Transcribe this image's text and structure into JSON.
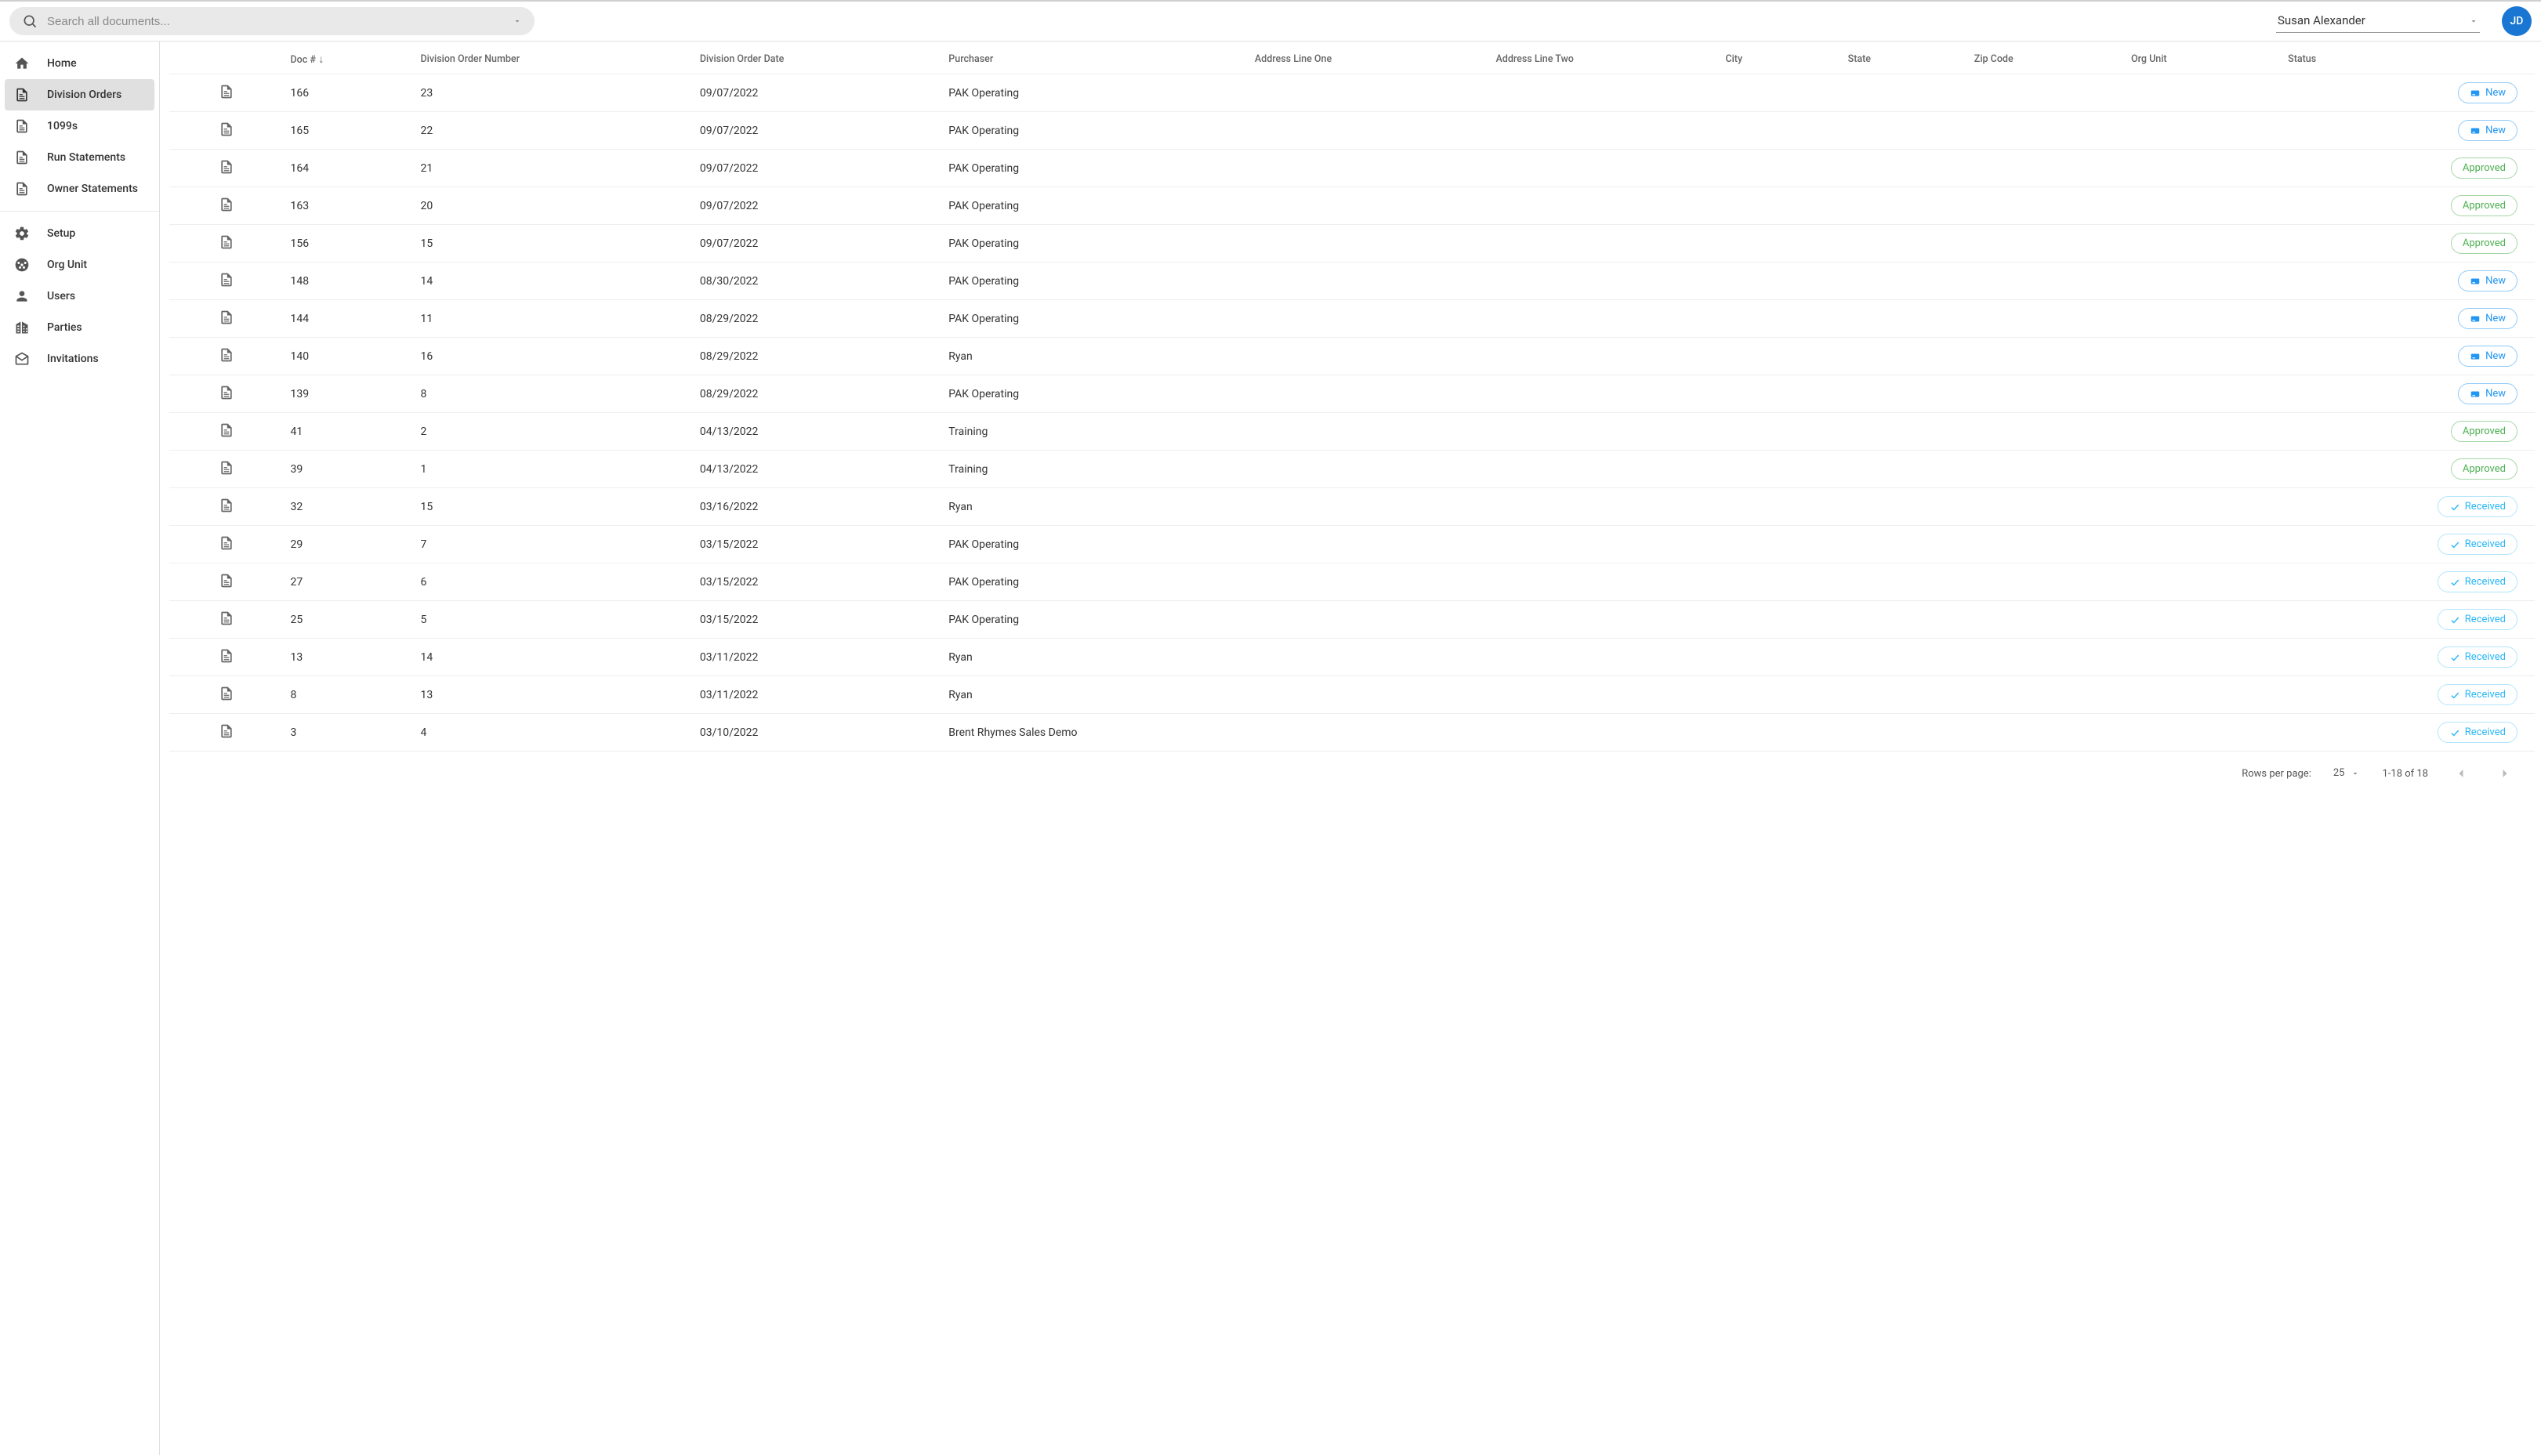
{
  "header": {
    "search_placeholder": "Search all documents...",
    "user_name": "Susan Alexander",
    "avatar_initials": "JD"
  },
  "sidebar": {
    "items": [
      {
        "icon": "home",
        "label": "Home"
      },
      {
        "icon": "doc",
        "label": "Division Orders",
        "active": true
      },
      {
        "icon": "doc",
        "label": "1099s"
      },
      {
        "icon": "doc",
        "label": "Run Statements"
      },
      {
        "icon": "doc",
        "label": "Owner Statements"
      },
      {
        "divider": true
      },
      {
        "icon": "gear",
        "label": "Setup"
      },
      {
        "icon": "org",
        "label": "Org Unit"
      },
      {
        "icon": "user",
        "label": "Users"
      },
      {
        "icon": "building",
        "label": "Parties"
      },
      {
        "icon": "mail",
        "label": "Invitations"
      }
    ]
  },
  "table": {
    "columns": [
      {
        "key": "icon",
        "label": ""
      },
      {
        "key": "doc_num",
        "label": "Doc #",
        "sorted": "desc"
      },
      {
        "key": "don",
        "label": "Division Order Number"
      },
      {
        "key": "date",
        "label": "Division Order Date"
      },
      {
        "key": "purchaser",
        "label": "Purchaser"
      },
      {
        "key": "addr1",
        "label": "Address Line One"
      },
      {
        "key": "addr2",
        "label": "Address Line Two"
      },
      {
        "key": "city",
        "label": "City"
      },
      {
        "key": "state",
        "label": "State"
      },
      {
        "key": "zip",
        "label": "Zip Code"
      },
      {
        "key": "org",
        "label": "Org Unit"
      },
      {
        "key": "status",
        "label": "Status"
      }
    ],
    "rows": [
      {
        "doc_num": "166",
        "don": "23",
        "date": "09/07/2022",
        "purchaser": "PAK Operating",
        "status": "New"
      },
      {
        "doc_num": "165",
        "don": "22",
        "date": "09/07/2022",
        "purchaser": "PAK Operating",
        "status": "New"
      },
      {
        "doc_num": "164",
        "don": "21",
        "date": "09/07/2022",
        "purchaser": "PAK Operating",
        "status": "Approved"
      },
      {
        "doc_num": "163",
        "don": "20",
        "date": "09/07/2022",
        "purchaser": "PAK Operating",
        "status": "Approved"
      },
      {
        "doc_num": "156",
        "don": "15",
        "date": "09/07/2022",
        "purchaser": "PAK Operating",
        "status": "Approved"
      },
      {
        "doc_num": "148",
        "don": "14",
        "date": "08/30/2022",
        "purchaser": "PAK Operating",
        "status": "New"
      },
      {
        "doc_num": "144",
        "don": "11",
        "date": "08/29/2022",
        "purchaser": "PAK Operating",
        "status": "New"
      },
      {
        "doc_num": "140",
        "don": "16",
        "date": "08/29/2022",
        "purchaser": "Ryan",
        "status": "New"
      },
      {
        "doc_num": "139",
        "don": "8",
        "date": "08/29/2022",
        "purchaser": "PAK Operating",
        "status": "New"
      },
      {
        "doc_num": "41",
        "don": "2",
        "date": "04/13/2022",
        "purchaser": "Training",
        "status": "Approved"
      },
      {
        "doc_num": "39",
        "don": "1",
        "date": "04/13/2022",
        "purchaser": "Training",
        "status": "Approved"
      },
      {
        "doc_num": "32",
        "don": "15",
        "date": "03/16/2022",
        "purchaser": "Ryan",
        "status": "Received"
      },
      {
        "doc_num": "29",
        "don": "7",
        "date": "03/15/2022",
        "purchaser": "PAK Operating",
        "status": "Received"
      },
      {
        "doc_num": "27",
        "don": "6",
        "date": "03/15/2022",
        "purchaser": "PAK Operating",
        "status": "Received"
      },
      {
        "doc_num": "25",
        "don": "5",
        "date": "03/15/2022",
        "purchaser": "PAK Operating",
        "status": "Received"
      },
      {
        "doc_num": "13",
        "don": "14",
        "date": "03/11/2022",
        "purchaser": "Ryan",
        "status": "Received"
      },
      {
        "doc_num": "8",
        "don": "13",
        "date": "03/11/2022",
        "purchaser": "Ryan",
        "status": "Received"
      },
      {
        "doc_num": "3",
        "don": "4",
        "date": "03/10/2022",
        "purchaser": "Brent Rhymes Sales Demo",
        "status": "Received"
      }
    ]
  },
  "pagination": {
    "rows_per_page_label": "Rows per page:",
    "rows_per_page_value": "25",
    "range_text": "1-18 of 18"
  }
}
